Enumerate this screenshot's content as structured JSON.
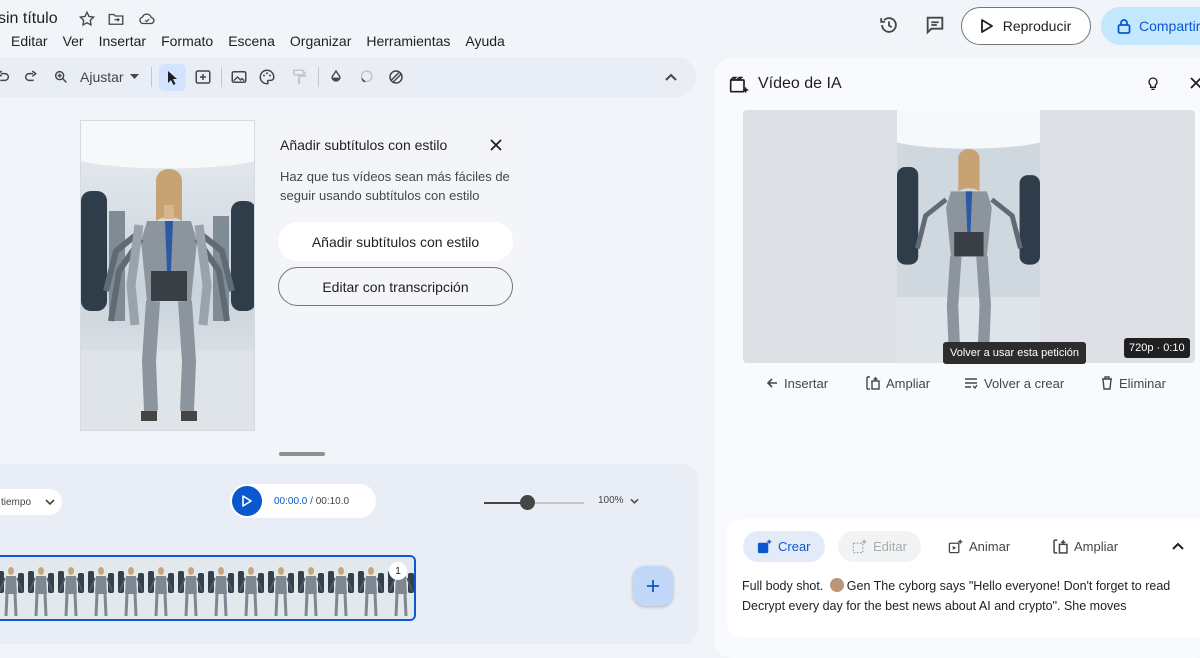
{
  "header": {
    "doc_title": "sin título",
    "menu": [
      "Editar",
      "Ver",
      "Insertar",
      "Formato",
      "Escena",
      "Organizar",
      "Herramientas",
      "Ayuda"
    ],
    "play_label": "Reproducir",
    "share_label": "Compartir"
  },
  "toolbar": {
    "zoom_label": "Ajustar"
  },
  "subtitles_card": {
    "title": "Añadir subtítulos con estilo",
    "description": "Haz que tus vídeos sean más fáciles de seguir usando subtítulos con estilo",
    "primary_button": "Añadir subtítulos con estilo",
    "secondary_button": "Editar con transcripción"
  },
  "timeline": {
    "mode_label": "tiempo",
    "current_time": "00:00.0",
    "total_time": "/ 00:10.0",
    "zoom_percent": "100%",
    "zoom_level": 0.43,
    "clip_count": "1"
  },
  "side_panel": {
    "title": "Vídeo de IA",
    "quality_badge": "720p · 0:10",
    "tooltip": "Volver a usar esta petición",
    "actions": [
      "Insertar",
      "Ampliar",
      "Volver a crear",
      "Eliminar"
    ],
    "prompt_tabs": [
      "Crear",
      "Editar",
      "Animar",
      "Ampliar"
    ],
    "prompt_text_before": "Full body shot.",
    "prompt_mention": "Gen",
    "prompt_text_after": "The cyborg says \"Hello everyone! Don't forget to read Decrypt every day for the best news about AI and crypto\". She moves"
  },
  "icons": [
    "star-icon",
    "move-to-folder-icon",
    "cloud-icon",
    "history-icon",
    "comment-icon",
    "play-icon",
    "lock-icon",
    "undo-icon",
    "redo-icon",
    "zoom-icon",
    "pointer-icon",
    "text-box-icon",
    "image-icon",
    "palette-icon",
    "paint-format-icon",
    "fill-icon",
    "shape-icon",
    "link-icon",
    "chevron-up-icon",
    "close-icon",
    "lightbulb-icon",
    "add-icon"
  ],
  "colors": {
    "accent": "#0b57d0",
    "share_bg": "#c2e7ff",
    "selected_tool": "#d3e3fd"
  }
}
